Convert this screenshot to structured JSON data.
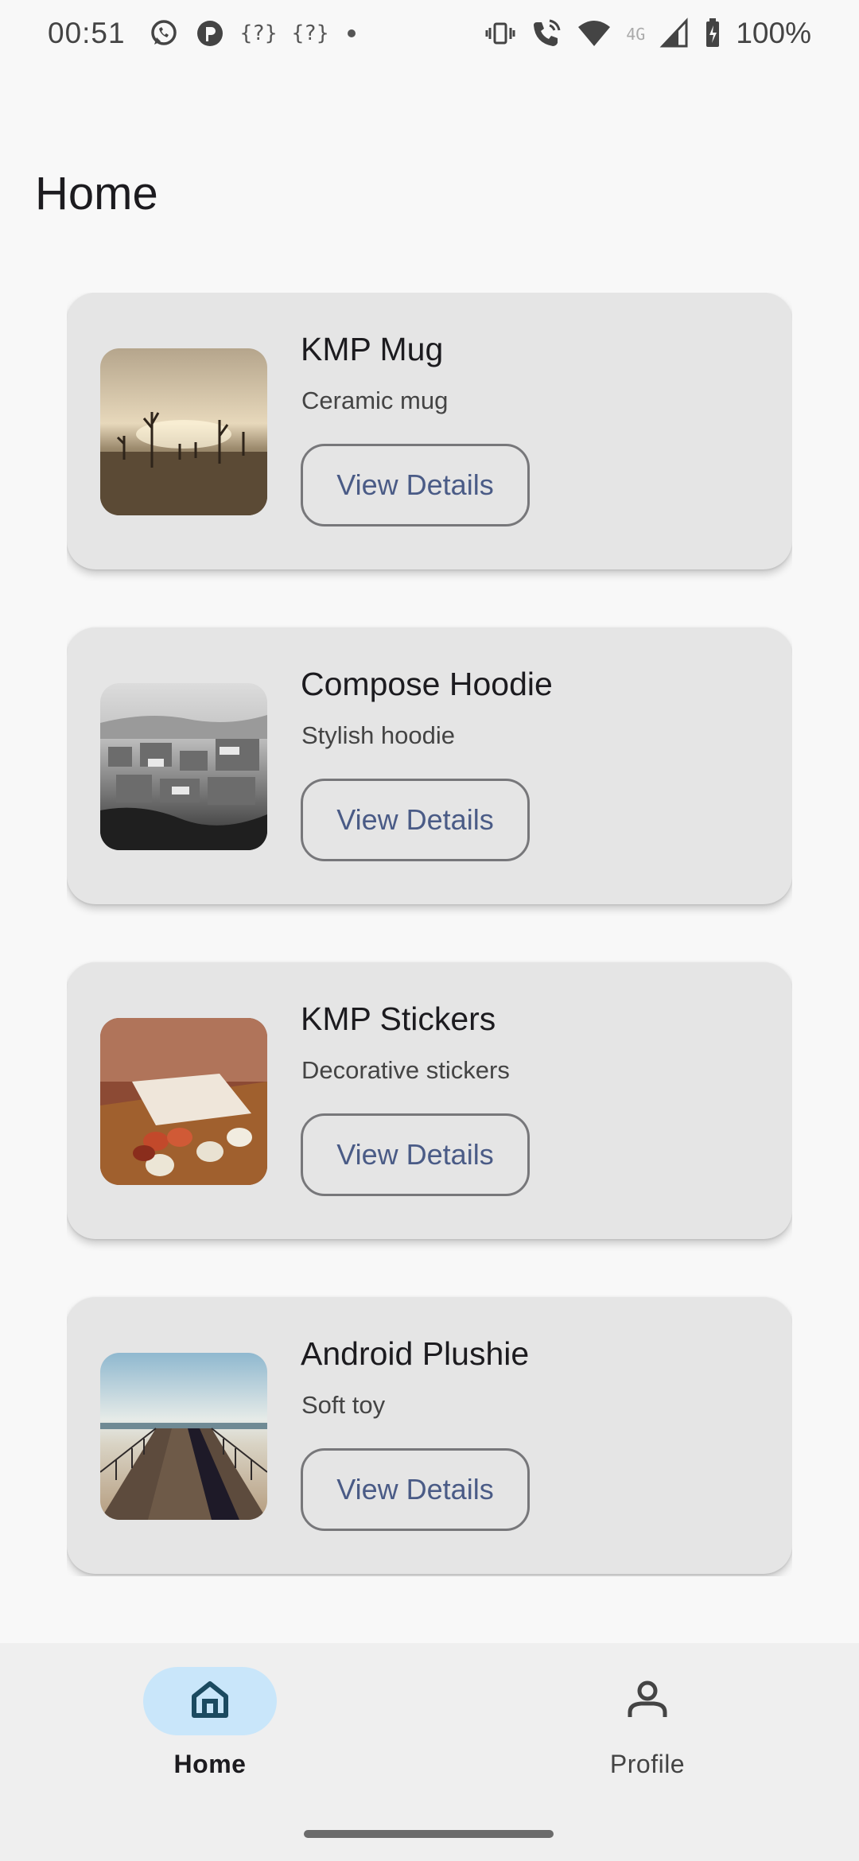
{
  "status_bar": {
    "time": "00:51",
    "left_icons": [
      "whatsapp-icon",
      "messenger-icon",
      "{?}",
      "{?}",
      "dot-icon"
    ],
    "right_icons": [
      "vibrate-icon",
      "wifi-calling-icon",
      "wifi-icon",
      "4G",
      "signal-icon",
      "battery-icon"
    ],
    "network": "4G",
    "battery": "100%"
  },
  "page": {
    "title": "Home"
  },
  "products": [
    {
      "name": "KMP Mug",
      "description": "Ceramic mug",
      "button": "View Details",
      "image": "desert-dead-trees-photo"
    },
    {
      "name": "Compose Hoodie",
      "description": "Stylish hoodie",
      "button": "View Details",
      "image": "city-aerial-bw-photo"
    },
    {
      "name": "KMP Stickers",
      "description": "Decorative stickers",
      "button": "View Details",
      "image": "cups-on-table-photo"
    },
    {
      "name": "Android Plushie",
      "description": "Soft toy",
      "button": "View Details",
      "image": "pier-boardwalk-photo"
    }
  ],
  "bottom_nav": {
    "items": [
      {
        "label": "Home",
        "icon": "home-icon",
        "selected": true
      },
      {
        "label": "Profile",
        "icon": "person-icon",
        "selected": false
      }
    ]
  },
  "colors": {
    "background": "#f8f8f8",
    "card": "#e5e5e5",
    "button_text": "#4a5b86",
    "nav_active_pill": "#c9e6fa",
    "nav_icon_active": "#1b4a60"
  }
}
